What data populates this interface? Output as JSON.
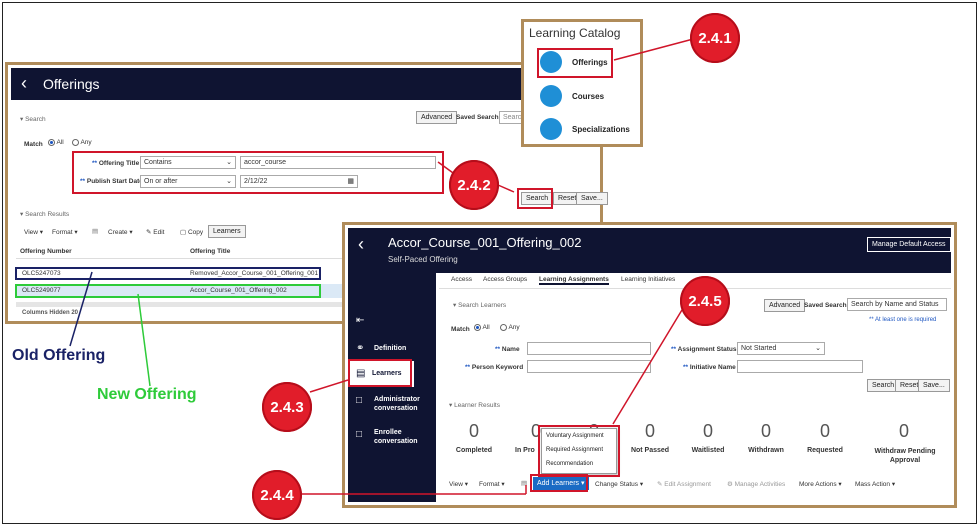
{
  "catalog": {
    "title": "Learning Catalog",
    "items": [
      "Offerings",
      "Courses",
      "Specializations"
    ]
  },
  "offerings_page": {
    "title": "Offerings",
    "search_label": "Search",
    "advanced_label": "Advanced",
    "saved_search_label": "Saved Search",
    "saved_search_placeholder": "Searc",
    "match_label": "Match",
    "match_all": "All",
    "match_any": "Any",
    "offering_title_label": "Offering Title",
    "offering_title_op": "Contains",
    "offering_title_value": "accor_course",
    "publish_date_label": "Publish Start Date",
    "publish_date_op": "On or after",
    "publish_date_value": "2/12/22",
    "search_btn": "Search",
    "reset_btn": "Reset",
    "save_btn": "Save...",
    "results_label": "Search Results",
    "toolbar": {
      "view": "View",
      "format": "Format",
      "create": "Create",
      "edit": "Edit",
      "copy": "Copy",
      "learners": "Learners"
    },
    "columns": [
      "Offering Number",
      "Offering Title"
    ],
    "rows": [
      {
        "number": "OLC5247073",
        "title": "Removed_Accor_Course_001_Offering_001"
      },
      {
        "number": "OLC5249077",
        "title": "Accor_Course_001_Offering_002"
      }
    ],
    "columns_hidden": "Columns Hidden 20"
  },
  "labels": {
    "old": "Old Offering",
    "new": "New Offering"
  },
  "callouts": {
    "c241": "2.4.1",
    "c242": "2.4.2",
    "c243": "2.4.3",
    "c244": "2.4.4",
    "c245": "2.4.5"
  },
  "learners_page": {
    "title": "Accor_Course_001_Offering_002",
    "subtitle": "Self-Paced Offering",
    "manage_btn": "Manage Default Access",
    "tabs": [
      "Access",
      "Access Groups",
      "Learning Assignments",
      "Learning Initiatives"
    ],
    "side": [
      "Definition",
      "Learners",
      "Administrator conversation",
      "Enrollee conversation"
    ],
    "search_label": "Search Learners",
    "advanced_label": "Advanced",
    "saved_search_label": "Saved Search",
    "saved_search_value": "Search by Name and Status",
    "required_note": "** At least one is required",
    "match_label": "Match",
    "match_all": "All",
    "match_any": "Any",
    "name_label": "Name",
    "assignment_status_label": "Assignment Status",
    "assignment_status_value": "Not Started",
    "person_keyword_label": "Person Keyword",
    "initiative_name_label": "Initiative Name",
    "search_btn": "Search",
    "reset_btn": "Reset",
    "save_btn": "Save...",
    "results_label": "Learner Results",
    "stats": [
      {
        "value": "0",
        "label": "Completed"
      },
      {
        "value": "0",
        "label": "In Pro"
      },
      {
        "value": "0",
        "label": ""
      },
      {
        "value": "0",
        "label": "Not Passed"
      },
      {
        "value": "0",
        "label": "Waitlisted"
      },
      {
        "value": "0",
        "label": "Withdrawn"
      },
      {
        "value": "0",
        "label": "Requested"
      },
      {
        "value": "0",
        "label": "Withdraw Pending Approval"
      }
    ],
    "dropdown": [
      "Voluntary Assignment",
      "Required Assignment",
      "Recommendation"
    ],
    "toolbar": {
      "view": "View",
      "format": "Format",
      "add": "Add Learners",
      "change": "Change Status",
      "edit": "Edit Assignment",
      "manage": "Manage Activities",
      "more": "More Actions",
      "mass": "Mass Action"
    }
  }
}
